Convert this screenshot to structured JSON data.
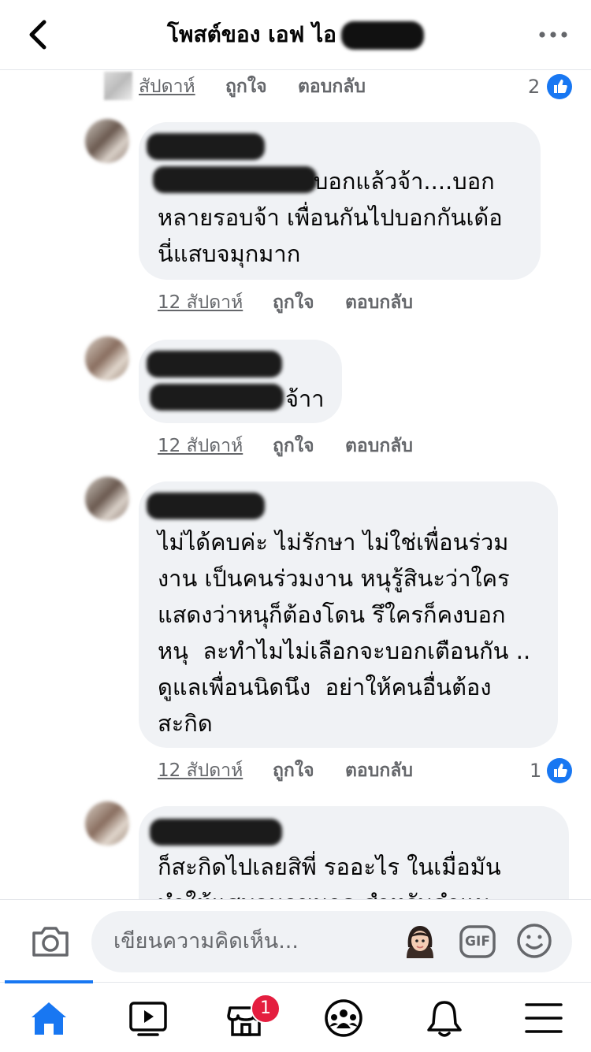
{
  "header": {
    "title": "โพสต์ของ เอฟ ไอ"
  },
  "comments": [
    {
      "time": "สัปดาห์",
      "like": "ถูกใจ",
      "reply": "ตอบกลับ",
      "reactions": "2"
    },
    {
      "lines": [
        "บอกแล้วจ้า....บอก",
        "หลายรอบจ้า เพื่อนกันไปบอกกันเด้อ",
        "นี่แสบจมุกมาก"
      ],
      "time": "12 สัปดาห์",
      "like": "ถูกใจ",
      "reply": "ตอบกลับ"
    },
    {
      "lines": [
        "จ้าา"
      ],
      "time": "12 สัปดาห์",
      "like": "ถูกใจ",
      "reply": "ตอบกลับ"
    },
    {
      "lines": [
        "ไม่ได้คบค่ะ ไม่รักษา ไม่ใช่เพื่อนร่วม",
        "งาน เป็นคนร่วมงาน หนุรู้สินะว่าใคร",
        "แสดงว่าหนุก็ต้องโดน รึใครก็คงบอก",
        "หนุ  ละทำไมไม่เลือกจะบอกเตือนกัน ..",
        "ดูแลเพื่อนนิดนึง  อย่าให้คนอื่นต้อง",
        "สะกิด"
      ],
      "time": "12 สัปดาห์",
      "like": "ถูกใจ",
      "reply": "ตอบกลับ",
      "reactions": "1"
    },
    {
      "lines": [
        "ก็สะกิดไปเลยสิพี่ รออะไร ในเมื่อมัน",
        "ทำให้แสบจมูกขนาด สำหรับคำแนะ"
      ]
    }
  ],
  "composer": {
    "placeholder": "เขียนความคิดเห็น...",
    "gif_label": "GIF"
  },
  "nav": {
    "notification_count": "1"
  },
  "colors": {
    "accent": "#1877f2",
    "bubble": "#f0f2f5",
    "meta": "#65676b",
    "badge": "#e41e3f"
  }
}
